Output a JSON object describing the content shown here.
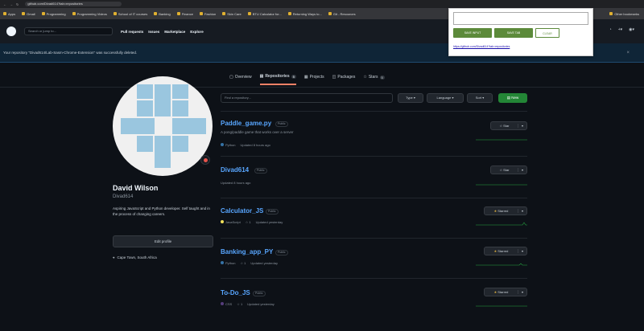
{
  "browser": {
    "url": "github.com/Divad614?tab=repositories",
    "bookmarks": [
      "Apps",
      "Gmail",
      "Programming",
      "Programming Videos",
      "School of IT courses",
      "Banking",
      "Finance",
      "Fashion",
      "Skin Care",
      "BTU Calculator for...",
      "Returning Ways to...",
      "Git - Resources",
      "Other bookmarks"
    ]
  },
  "header": {
    "search_placeholder": "Search or jump to...",
    "nav": [
      "Pull requests",
      "Issues",
      "Marketplace",
      "Explore"
    ]
  },
  "flash": {
    "message": "Your repository \"Divad614/Lab-Sasm-Chrome-Extension\" was successfully deleted.",
    "close": "×"
  },
  "popup": {
    "input_value": "",
    "btn_save_input": "SAVE INPUT",
    "btn_save_tab": "SAVE TAB",
    "btn_clear": "CLEAR",
    "link": "https://github.com/Divad614?tab=repositories"
  },
  "tabs": [
    {
      "label": "Overview",
      "count": ""
    },
    {
      "label": "Repositories",
      "count": "5"
    },
    {
      "label": "Projects",
      "count": ""
    },
    {
      "label": "Packages",
      "count": ""
    },
    {
      "label": "Stars",
      "count": "5"
    }
  ],
  "profile": {
    "name": "David Wilson",
    "login": "Divad614",
    "bio": "Aspiring JavaScript and Python developer. Self taught and in the process of changing careers.",
    "edit_label": "Edit profile",
    "location": "Cape Town, South Africa"
  },
  "filters": {
    "placeholder": "Find a repository...",
    "type": "Type ▾",
    "language": "Language ▾",
    "sort": "Sort ▾",
    "new": "New"
  },
  "repos": [
    {
      "name": "Paddle_game.py",
      "visibility": "Public",
      "description": "A pong/paddle game that works over a server",
      "language": "Python",
      "lang_color": "#3572A5",
      "stars": "",
      "updated": "Updated 8 hours ago",
      "star_label": "Star"
    },
    {
      "name": "Divad614",
      "visibility": "Public",
      "description": "",
      "language": "",
      "lang_color": "",
      "stars": "",
      "updated": "Updated 8 hours ago",
      "star_label": "Star"
    },
    {
      "name": "Calculator_JS",
      "visibility": "Public",
      "description": "",
      "language": "JavaScript",
      "lang_color": "#f1e05a",
      "stars": "1",
      "updated": "Updated yesterday",
      "star_label": "Starred"
    },
    {
      "name": "Banking_app_PY",
      "visibility": "Public",
      "description": "",
      "language": "Python",
      "lang_color": "#3572A5",
      "stars": "1",
      "updated": "Updated yesterday",
      "star_label": "Starred"
    },
    {
      "name": "To-Do_JS",
      "visibility": "Public",
      "description": "",
      "language": "CSS",
      "lang_color": "#563d7c",
      "stars": "1",
      "updated": "Updated yesterday",
      "star_label": "Starred"
    }
  ]
}
